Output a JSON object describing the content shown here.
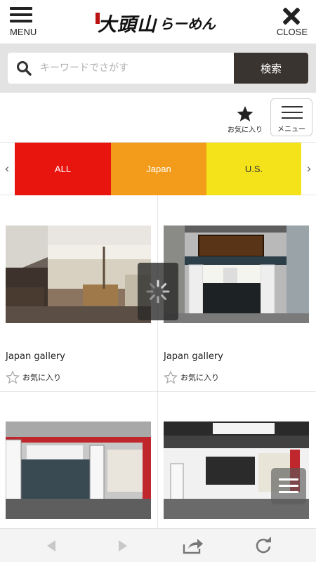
{
  "header": {
    "menu_label": "MENU",
    "close_label": "CLOSE",
    "logo_text": "大頭山",
    "logo_sub": "らーめん"
  },
  "search": {
    "placeholder": "キーワードでさがす",
    "button_label": "検索"
  },
  "tools": {
    "favorites_label": "お気に入り",
    "menu_label": "メニュー"
  },
  "tabs": [
    {
      "label": "ALL",
      "color": "#e8140e"
    },
    {
      "label": "Japan",
      "color": "#f39c1b"
    },
    {
      "label": "U.S.",
      "color": "#f4e21a"
    }
  ],
  "gallery": [
    {
      "title": "Japan gallery",
      "fav_label": "お気に入り"
    },
    {
      "title": "Japan gallery",
      "fav_label": "お気に入り"
    }
  ],
  "colors": {
    "search_button": "#3a3431",
    "search_band": "#e3e3e3"
  },
  "icons": {
    "menu": "hamburger-icon",
    "close": "close-icon",
    "search": "search-icon",
    "favorite": "star-icon",
    "back": "back-arrow-icon",
    "forward": "forward-arrow-icon",
    "share": "share-icon",
    "reload": "reload-icon"
  }
}
